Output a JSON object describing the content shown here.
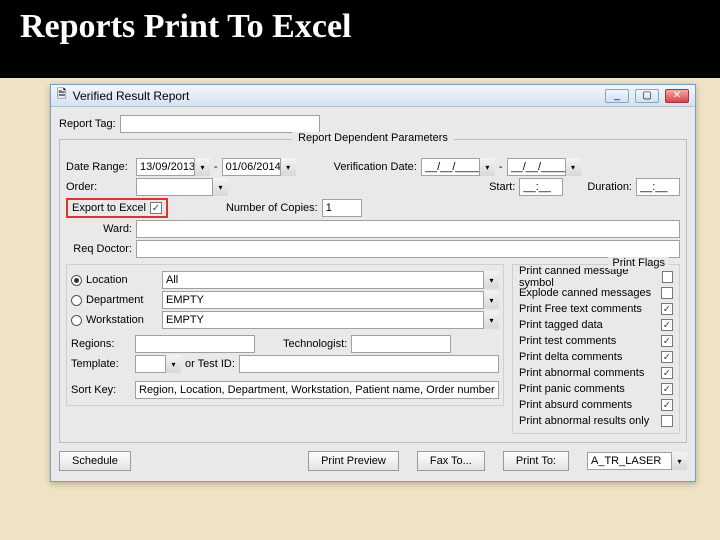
{
  "slide": {
    "title": "Reports Print To Excel"
  },
  "window": {
    "title": "Verified Result Report",
    "report_tag_label": "Report Tag:",
    "report_tag_value": "",
    "dep_params_legend": "Report Dependent Parameters",
    "date_range_label": "Date Range:",
    "date_from": "13/09/2013",
    "date_to": "01/06/2014",
    "date_sep": " - ",
    "verif_date_label": "Verification Date:",
    "verif_from": "__/__/____",
    "verif_to": "__/__/____",
    "order_label": "Order:",
    "order_value": "",
    "start_label": "Start:",
    "start_value": "__:__",
    "duration_label": "Duration:",
    "duration_value": "__:__",
    "export_label": "Export to Excel",
    "export_checked": "✓",
    "copies_label": "Number of Copies:",
    "copies_value": "1",
    "ward_label": "Ward:",
    "ward_value": "",
    "reqdoc_label": "Req Doctor:",
    "reqdoc_value": "",
    "scope": {
      "location_label": "Location",
      "department_label": "Department",
      "workstation_label": "Workstation",
      "location_value": "All",
      "department_value": "EMPTY",
      "workstation_value": "EMPTY"
    },
    "flags_legend": "Print Flags",
    "flags": [
      {
        "label": "Print canned message symbol",
        "checked": ""
      },
      {
        "label": "Explode canned messages",
        "checked": ""
      },
      {
        "label": "Print Free text comments",
        "checked": "✓"
      },
      {
        "label": "Print tagged data",
        "checked": "✓"
      },
      {
        "label": "Print test comments",
        "checked": "✓"
      },
      {
        "label": "Print delta comments",
        "checked": "✓"
      },
      {
        "label": "Print abnormal comments",
        "checked": "✓"
      },
      {
        "label": "Print panic comments",
        "checked": "✓"
      },
      {
        "label": "Print absurd comments",
        "checked": "✓"
      },
      {
        "label": "Print abnormal results only",
        "checked": ""
      }
    ],
    "regions_label": "Regions:",
    "regions_value": "",
    "technologist_label": "Technologist:",
    "technologist_value": "",
    "template_label": "Template:",
    "template_value": "",
    "ortestid_label": "or Test ID:",
    "ortestid_value": "",
    "sortkey_label": "Sort Key:",
    "sortkey_value": "Region, Location, Department, Workstation, Patient name, Order number, Gro",
    "buttons": {
      "schedule": "Schedule",
      "preview": "Print Preview",
      "fax": "Fax To...",
      "printto": "Print To:",
      "printer": "A_TR_LASER"
    }
  }
}
